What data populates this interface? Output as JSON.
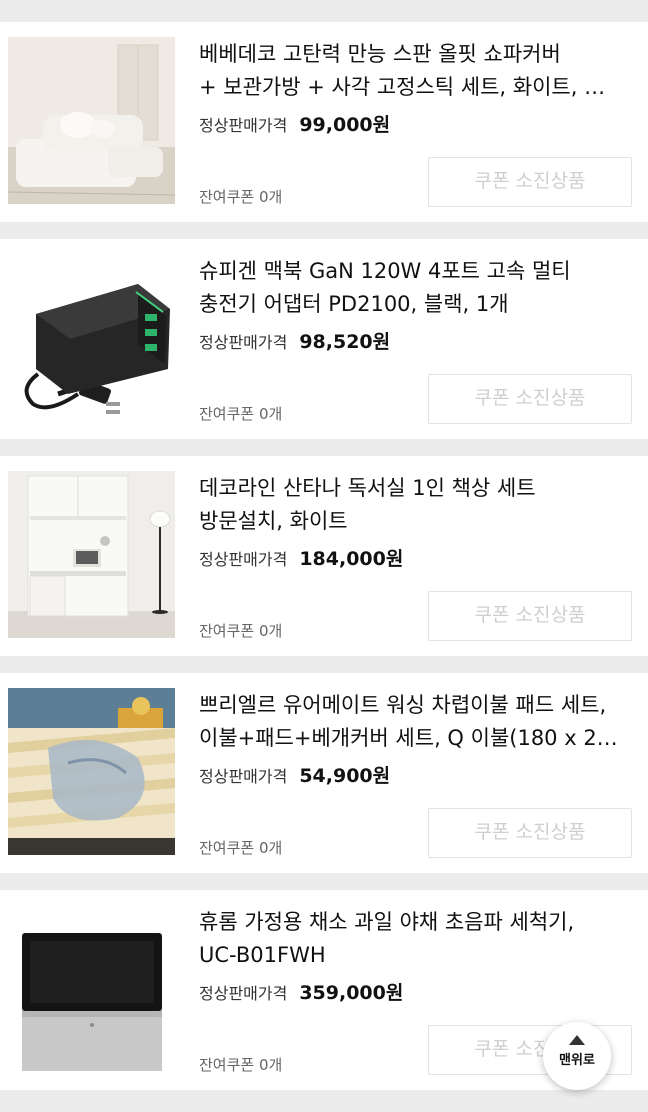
{
  "products": [
    {
      "title_line1": "베베데코 고탄력 만능 스판 올핏 쇼파커버",
      "title_line2": "+ 보관가방 + 사각 고정스틱 세트, 화이트, …",
      "price_label": "정상판매가격",
      "price": "99,000원",
      "coupon_info": "잔여쿠폰 0개",
      "coupon_button": "쿠폰 소진상품",
      "image": "white-sofa-image"
    },
    {
      "title_line1": "슈피겐 맥북 GaN 120W 4포트 고속 멀티",
      "title_line2": "충전기 어댑터 PD2100, 블랙, 1개",
      "price_label": "정상판매가격",
      "price": "98,520원",
      "coupon_info": "잔여쿠폰 0개",
      "coupon_button": "쿠폰 소진상품",
      "image": "black-charger-image"
    },
    {
      "title_line1": "데코라인 산타나 독서실 1인 책상 세트",
      "title_line2": "방문설치, 화이트",
      "price_label": "정상판매가격",
      "price": "184,000원",
      "coupon_info": "잔여쿠폰 0개",
      "coupon_button": "쿠폰 소진상품",
      "image": "white-desk-image"
    },
    {
      "title_line1": "쁘리엘르 유어메이트 워싱 차렵이불 패드 세트,",
      "title_line2": "이불+패드+베개커버 세트, Q 이불(180 x 2…",
      "price_label": "정상판매가격",
      "price": "54,900원",
      "coupon_info": "잔여쿠폰 0개",
      "coupon_button": "쿠폰 소진상품",
      "image": "bedding-set-image"
    },
    {
      "title_line1": "휴롬 가정용 채소 과일 야채 초음파 세척기,",
      "title_line2": "UC-B01FWH",
      "price_label": "정상판매가격",
      "price": "359,000원",
      "coupon_info": "잔여쿠폰 0개",
      "coupon_button": "쿠폰 소진상품",
      "image": "ultrasonic-washer-image"
    }
  ],
  "scroll_top_button": {
    "label": "맨위로",
    "icon": "arrow-up-icon"
  },
  "colors": {
    "page_background": "#ececec",
    "card_background": "#ffffff",
    "disabled_text": "#cfcfcf"
  }
}
